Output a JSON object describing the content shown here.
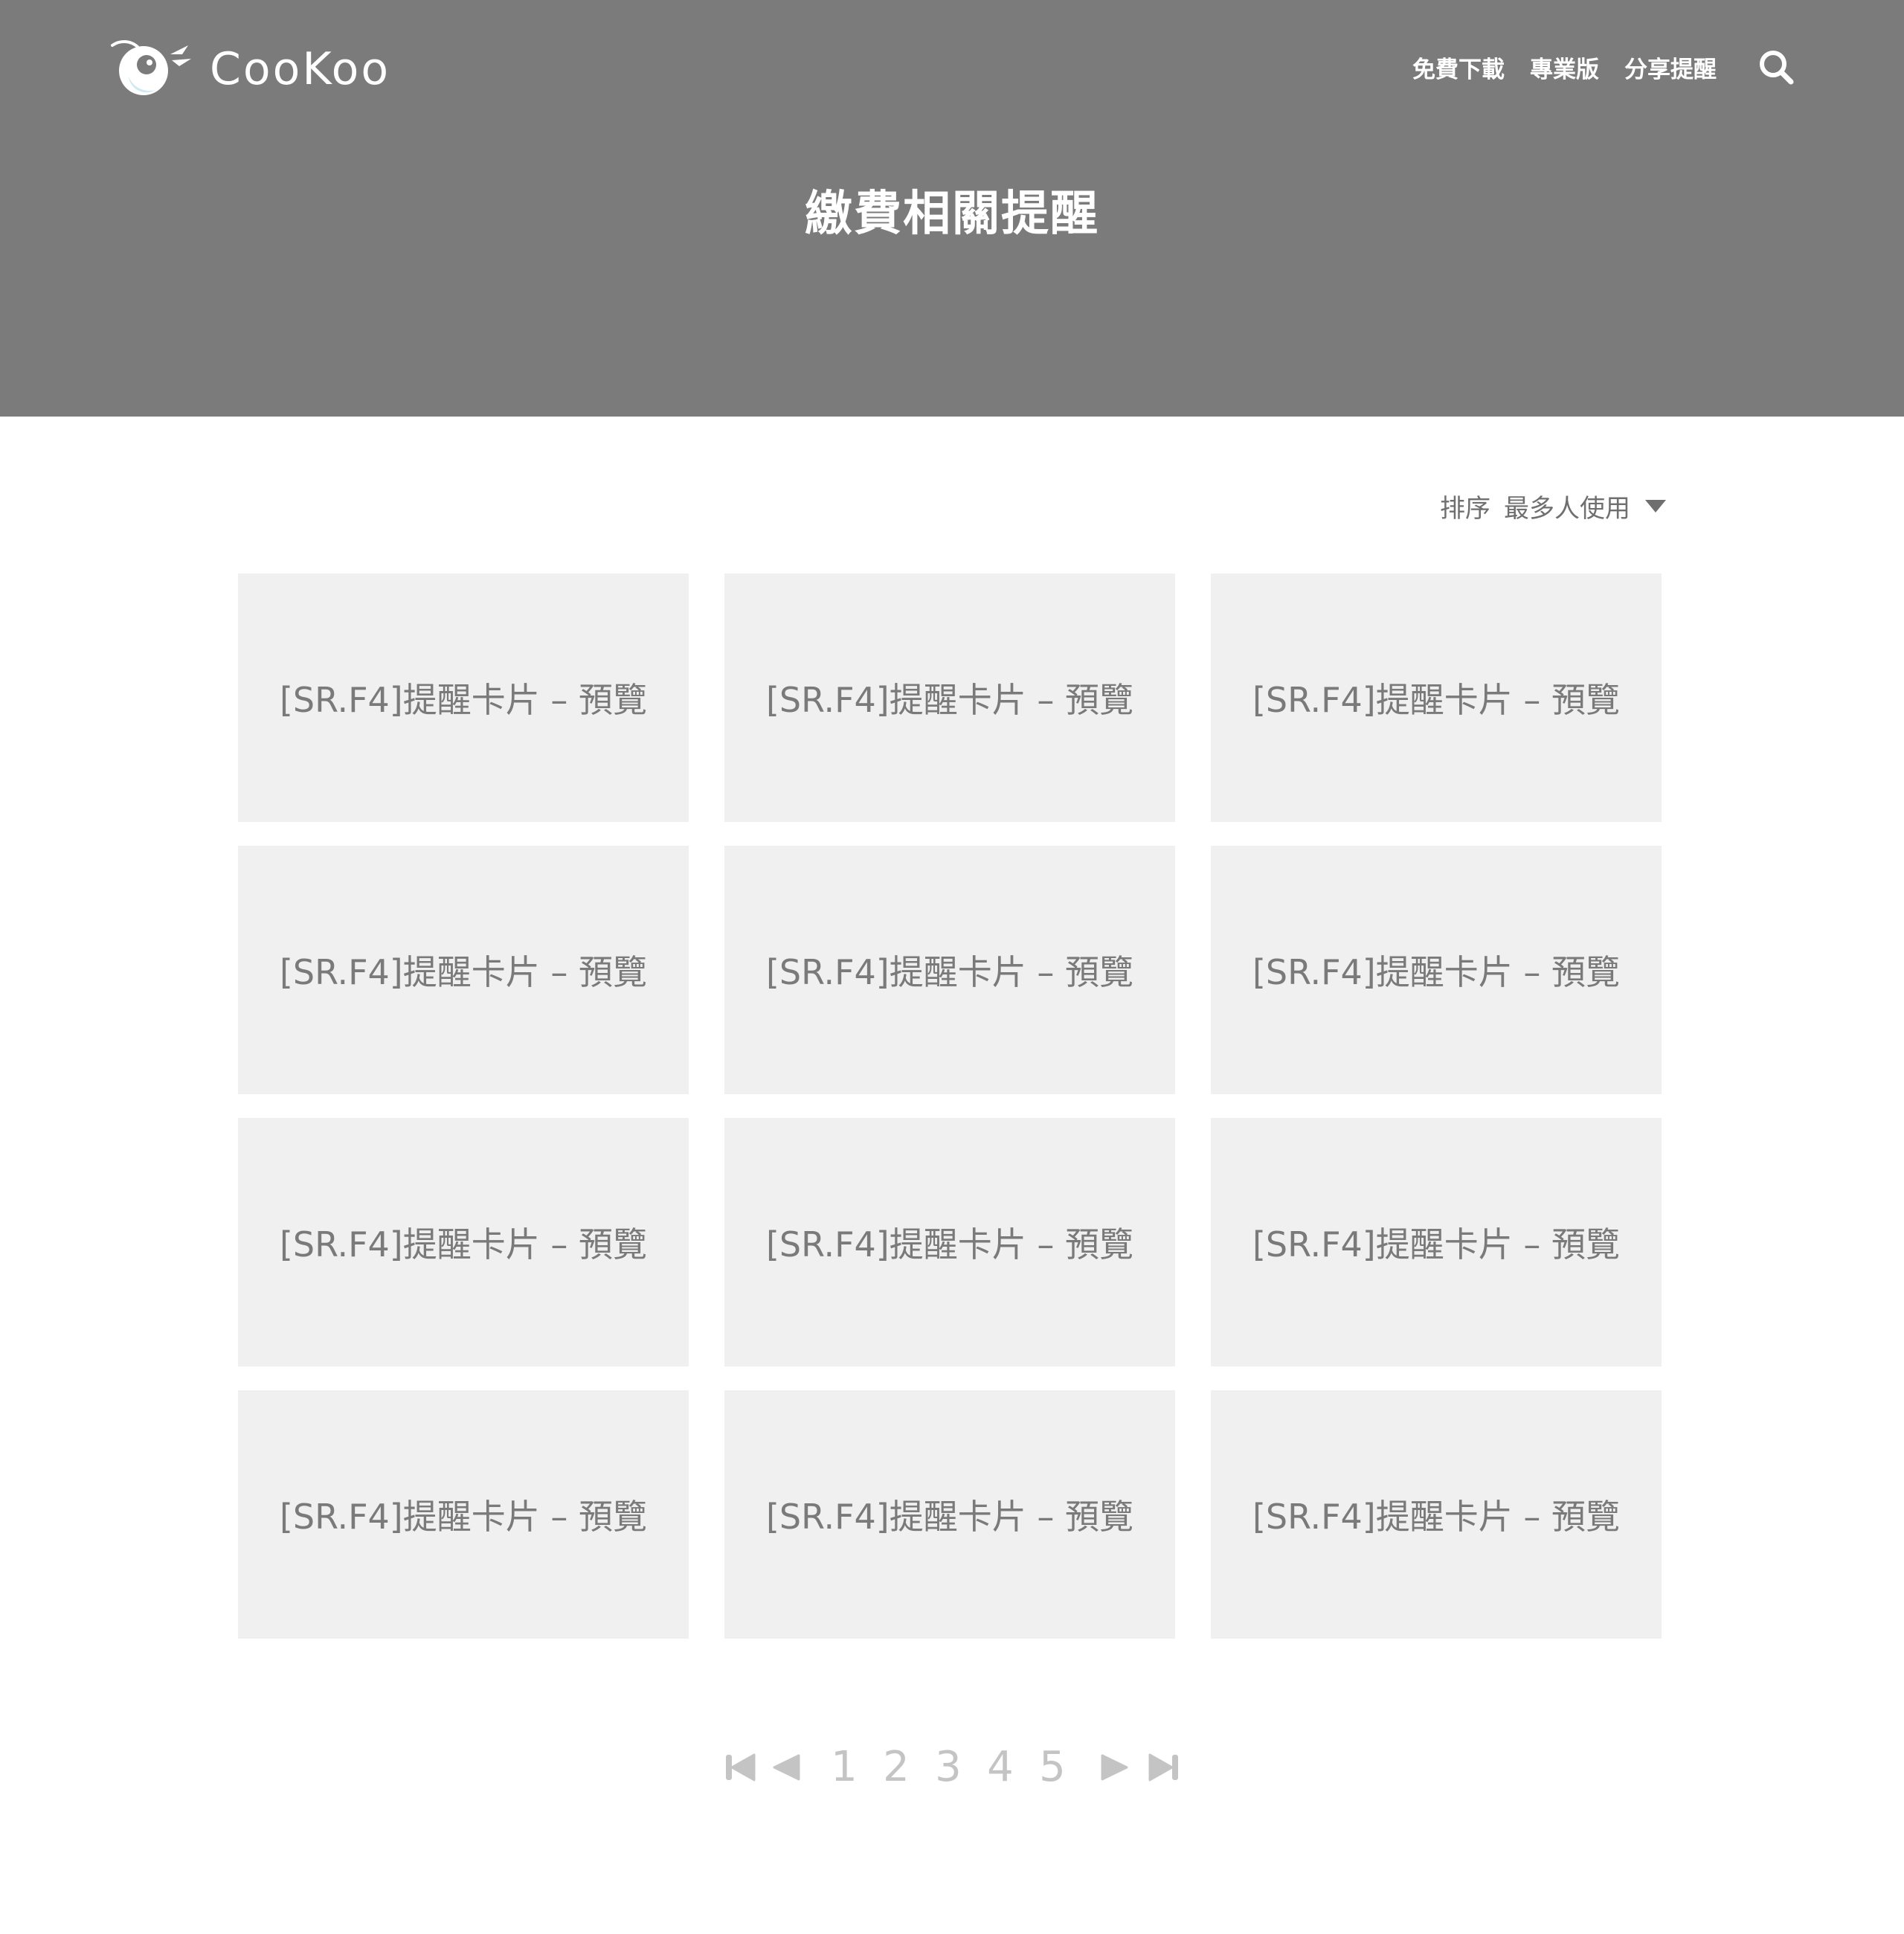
{
  "brand": {
    "name": "CooKoo",
    "logo_icon": "cookoo-bird-logo-icon"
  },
  "nav": {
    "items": [
      {
        "label": "免費下載"
      },
      {
        "label": "專業版"
      },
      {
        "label": "分享提醒"
      }
    ],
    "search_icon": "search-icon"
  },
  "page": {
    "title": "繳費相關提醒"
  },
  "sort": {
    "label": "排序",
    "value": "最多人使用",
    "caret_icon": "caret-down-icon"
  },
  "cards": [
    {
      "label": "[SR.F4]提醒卡片 – 預覽"
    },
    {
      "label": "[SR.F4]提醒卡片 – 預覽"
    },
    {
      "label": "[SR.F4]提醒卡片 – 預覽"
    },
    {
      "label": "[SR.F4]提醒卡片 – 預覽"
    },
    {
      "label": "[SR.F4]提醒卡片 – 預覽"
    },
    {
      "label": "[SR.F4]提醒卡片 – 預覽"
    },
    {
      "label": "[SR.F4]提醒卡片 – 預覽"
    },
    {
      "label": "[SR.F4]提醒卡片 – 預覽"
    },
    {
      "label": "[SR.F4]提醒卡片 – 預覽"
    },
    {
      "label": "[SR.F4]提醒卡片 – 預覽"
    },
    {
      "label": "[SR.F4]提醒卡片 – 預覽"
    },
    {
      "label": "[SR.F4]提醒卡片 – 預覽"
    }
  ],
  "pagination": {
    "pages": [
      "1",
      "2",
      "3",
      "4",
      "5"
    ],
    "icons": {
      "first": "first-page-icon",
      "prev": "previous-page-icon",
      "next": "next-page-icon",
      "last": "last-page-icon"
    }
  },
  "colors": {
    "hero_bg": "#7b7b7b",
    "card_bg": "#f0f0f0",
    "card_text": "#7a7a7a",
    "pager": "#c4c4c4",
    "logo_eye": "#dff1f7"
  }
}
